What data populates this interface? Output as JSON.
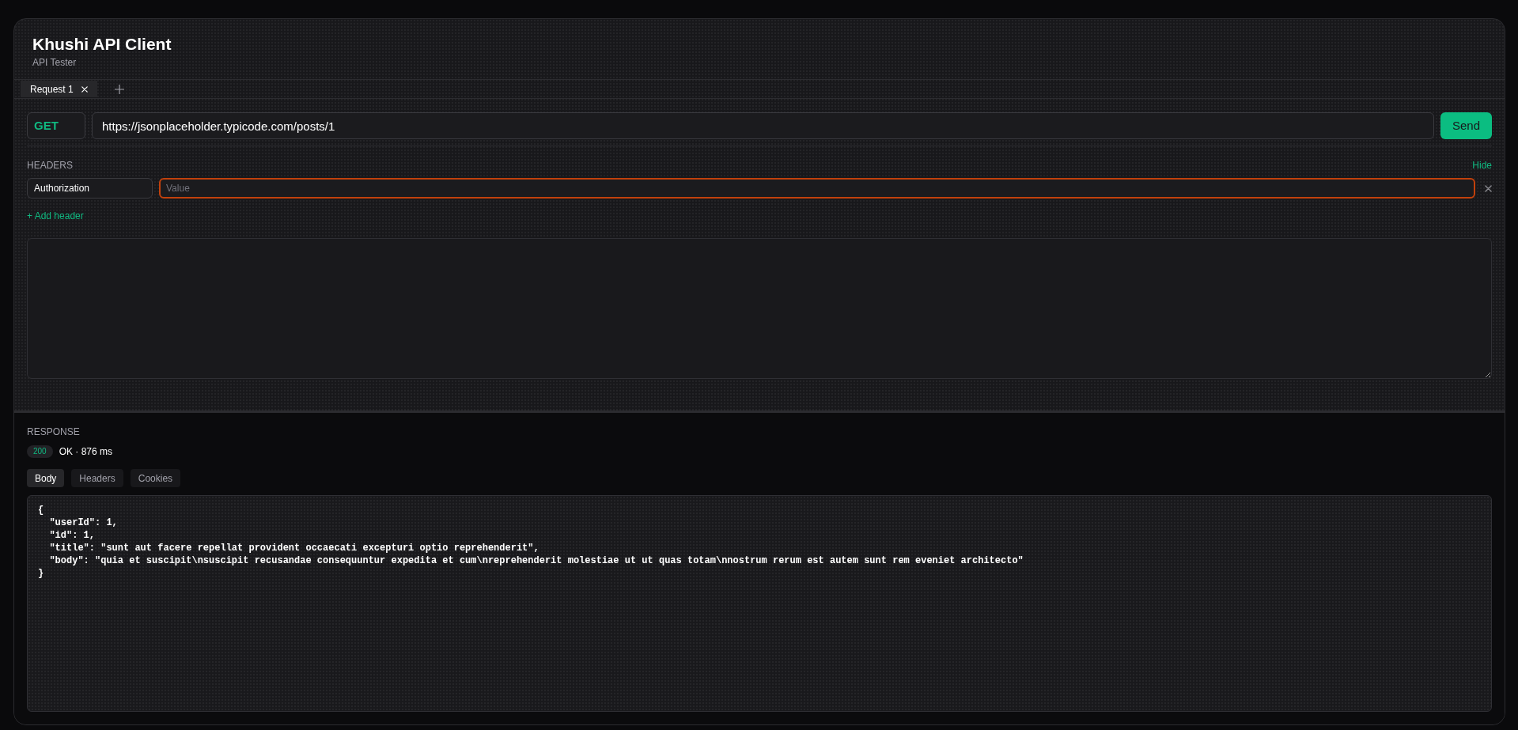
{
  "app": {
    "title": "Khushi API Client",
    "subtitle": "API Tester"
  },
  "tabs": [
    {
      "label": "Request 1",
      "selected": true
    }
  ],
  "request": {
    "method": "GET",
    "url": "https://jsonplaceholder.typicode.com/posts/1",
    "send": "Send"
  },
  "headers": {
    "label": "HEADERS",
    "toggle": "Hide",
    "expanded": true,
    "rows": [
      {
        "key": "Authorization",
        "value_placeholder": "Value",
        "focused": true
      }
    ],
    "add": "+ Add header"
  },
  "response": {
    "label": "RESPONSE",
    "status_code": "200",
    "status_text": "OK · 876 ms",
    "tabs": [
      {
        "label": "Body",
        "selected": true
      },
      {
        "label": "Headers",
        "selected": false
      },
      {
        "label": "Cookies",
        "selected": false
      }
    ],
    "body": "{\n  \"userId\": 1,\n  \"id\": 1,\n  \"title\": \"sunt aut facere repellat provident occaecati excepturi optio reprehenderit\",\n  \"body\": \"quia et suscipit\\nsuscipit recusandae consequuntur expedita et cum\\nreprehenderit molestiae ut ut quas totam\\nnostrum rerum est autem sunt rem eveniet architecto\"\n}"
  }
}
